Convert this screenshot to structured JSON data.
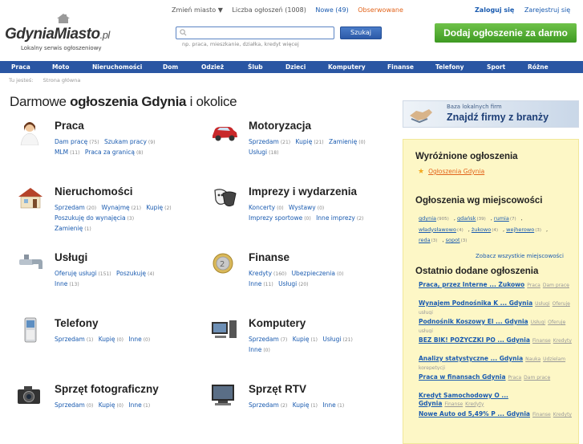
{
  "logo": {
    "text_main": "GdyniaMiasto",
    "text_suffix": ".pl",
    "tagline": "Lokalny serwis ogłoszeniowy"
  },
  "topbar": {
    "change_city": "Zmień miasto ▼",
    "count": "Liczba ogłoszeń (1008)",
    "new": "Nowe (49)",
    "observed": "Obserwowane"
  },
  "auth": {
    "login": "Zaloguj się",
    "register": "Zarejestruj się"
  },
  "search": {
    "placeholder": "",
    "hint": "np. praca, mieszkanie, działka, kredyt   więcej",
    "button": "Szukaj"
  },
  "add_button": "Dodaj ogłoszenie za darmo",
  "nav": [
    "Praca",
    "Moto",
    "Nieruchomości",
    "Dom",
    "Odzież",
    "Ślub",
    "Dzieci",
    "Komputery",
    "Finanse",
    "Telefony",
    "Sport",
    "Różne"
  ],
  "breadcrumb": {
    "you_are": "Tu jesteś:",
    "home": "Strona główna"
  },
  "heading": {
    "part1": "Darmowe ",
    "part2": "ogłoszenia Gdynia",
    "part3": " i okolice"
  },
  "categories": [
    {
      "title": "Praca",
      "icon": "woman-icon",
      "links": [
        [
          "Dam pracę",
          "(75)"
        ],
        [
          "Szukam pracy",
          "(9)"
        ],
        [
          "MLM",
          "(11)"
        ],
        [
          "Praca za granicą",
          "(8)"
        ]
      ]
    },
    {
      "title": "Motoryzacja",
      "icon": "car-icon",
      "links": [
        [
          "Sprzedam",
          "(21)"
        ],
        [
          "Kupię",
          "(21)"
        ],
        [
          "Zamienię",
          "(0)"
        ],
        [
          "Usługi",
          "(18)"
        ]
      ]
    },
    {
      "title": "Nieruchomości",
      "icon": "house-icon",
      "links": [
        [
          "Sprzedam",
          "(20)"
        ],
        [
          "Wynajmę",
          "(21)"
        ],
        [
          "Kupię",
          "(2)"
        ],
        [
          "Poszukuję do wynajęcia",
          "(3)"
        ],
        [
          "Zamienię",
          "(1)"
        ]
      ]
    },
    {
      "title": "Imprezy i wydarzenia",
      "icon": "masks-icon",
      "links": [
        [
          "Koncerty",
          "(0)"
        ],
        [
          "Wystawy",
          "(0)"
        ],
        [
          "Imprezy sportowe",
          "(0)"
        ],
        [
          "Inne imprezy",
          "(2)"
        ]
      ]
    },
    {
      "title": "Usługi",
      "icon": "faucet-icon",
      "links": [
        [
          "Oferuję usługi",
          "(151)"
        ],
        [
          "Poszukuję",
          "(4)"
        ],
        [
          "Inne",
          "(13)"
        ]
      ]
    },
    {
      "title": "Finanse",
      "icon": "coin-icon",
      "links": [
        [
          "Kredyty",
          "(160)"
        ],
        [
          "Ubezpieczenia",
          "(0)"
        ],
        [
          "Inne",
          "(11)"
        ],
        [
          "Usługi",
          "(20)"
        ]
      ]
    },
    {
      "title": "Telefony",
      "icon": "phone-icon",
      "links": [
        [
          "Sprzedam",
          "(1)"
        ],
        [
          "Kupię",
          "(0)"
        ],
        [
          "Inne",
          "(0)"
        ]
      ]
    },
    {
      "title": "Komputery",
      "icon": "computer-icon",
      "links": [
        [
          "Sprzedam",
          "(7)"
        ],
        [
          "Kupię",
          "(1)"
        ],
        [
          "Usługi",
          "(21)"
        ],
        [
          "Inne",
          "(0)"
        ]
      ]
    },
    {
      "title": "Sprzęt fotograficzny",
      "icon": "camera-icon",
      "links": [
        [
          "Sprzedam",
          "(0)"
        ],
        [
          "Kupię",
          "(0)"
        ],
        [
          "Inne",
          "(1)"
        ]
      ]
    },
    {
      "title": "Sprzęt RTV",
      "icon": "tv-icon",
      "links": [
        [
          "Sprzedam",
          "(2)"
        ],
        [
          "Kupię",
          "(1)"
        ],
        [
          "Inne",
          "(1)"
        ]
      ]
    }
  ],
  "banner": {
    "line1": "Baza lokalnych firm",
    "line2": "Znajdź firmy z branży"
  },
  "sidebar": {
    "featured_title": "Wyróżnione ogłoszenia",
    "featured_link": "Ogłoszenia Gdynia",
    "cities_title": "Ogłoszenia wg miejscowości",
    "cities": [
      [
        "gdynia",
        "(905)"
      ],
      [
        "gdańsk",
        "(39)"
      ],
      [
        "rumia",
        "(7)"
      ],
      [
        "władysławowo",
        "(4)"
      ],
      [
        "żukowo",
        "(4)"
      ],
      [
        "wejherowo",
        "(3)"
      ],
      [
        "reda",
        "(3)"
      ],
      [
        "sopot",
        "(3)"
      ]
    ],
    "all_cities": "Zobacz wszystkie miejscowości",
    "recent_title": "Ostatnio dodane ogłoszenia",
    "recent": [
      {
        "title": "Praca, przez Interne ... Żukowo",
        "cat": "Praca",
        "sub": "Dam pracę"
      },
      {
        "title": "Wynajem Podnośnika K ... Gdynia",
        "cat": "Usługi",
        "sub": "Oferuję usługi"
      },
      {
        "title": "Podnośnik Koszowy El ... Gdynia",
        "cat": "Usługi",
        "sub": "Oferuję usługi"
      },
      {
        "title": "BEZ BIK! POŻYCZKI PO ... Gdynia",
        "cat": "Finanse",
        "sub": "Kredyty"
      },
      {
        "title": "Analizy statystyczne ... Gdynia",
        "cat": "Nauka",
        "sub": "Udzielam korepetycji"
      },
      {
        "title": "Praca w finansach Gdynia",
        "cat": "Praca",
        "sub": "Dam pracę"
      },
      {
        "title": "Kredyt Samochodowy O ... Gdynia",
        "cat": "Finanse",
        "sub": "Kredyty"
      },
      {
        "title": "Nowe Auto od 5,49% P ... Gdynia",
        "cat": "Finanse",
        "sub": "Kredyty"
      }
    ]
  }
}
